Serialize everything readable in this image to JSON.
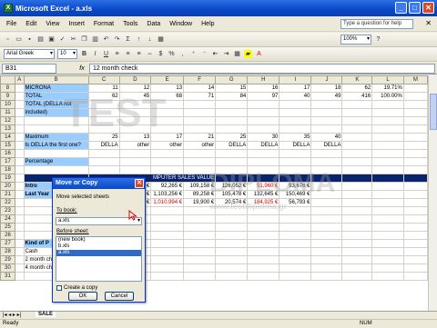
{
  "window": {
    "title": "Microsoft Excel - a.xls",
    "min": "_",
    "max": "□",
    "close": "✕"
  },
  "menus": [
    "File",
    "Edit",
    "View",
    "Insert",
    "Format",
    "Tools",
    "Data",
    "Window",
    "Help"
  ],
  "ask_box": "Type a question for help",
  "menu_close": "✕",
  "toolbar": {
    "zoom": "100%",
    "font": "Arial Greek",
    "size": "10",
    "bold": "B",
    "italic": "I",
    "underline": "U",
    "currency": "$",
    "percent": "%",
    "comma": ",",
    "fx": "fx"
  },
  "formula_bar": {
    "name_box": "B31",
    "content": "12 month check"
  },
  "sheet": {
    "columns": [
      "A",
      "B",
      "C",
      "D",
      "E",
      "F",
      "G",
      "H",
      "I",
      "J",
      "K",
      "L",
      "M"
    ],
    "rows": [
      {
        "n": "8",
        "b": "MICRONA",
        "c": "11",
        "d": "12",
        "e": "13",
        "f": "14",
        "g": "15",
        "h": "16",
        "i": "17",
        "j": "18",
        "k": "62",
        "l": "19.71%"
      },
      {
        "n": "9",
        "b": "TOTAL",
        "c": "62",
        "d": "45",
        "e": "68",
        "f": "71",
        "g": "84",
        "h": "97",
        "i": "40",
        "j": "49",
        "k": "416",
        "l": "100.00%"
      },
      {
        "n": "10",
        "b": "TOTAL (DELLA not",
        "c": "",
        "d": "",
        "e": "",
        "f": "",
        "g": "",
        "h": "",
        "i": "",
        "j": "",
        "k": "",
        "l": ""
      },
      {
        "n": "11",
        "b": "included)",
        "c": "",
        "d": "",
        "e": "",
        "f": "",
        "g": "",
        "h": "",
        "i": "",
        "j": "",
        "k": "",
        "l": ""
      },
      {
        "n": "12",
        "b": "",
        "c": "",
        "d": "",
        "e": "",
        "f": "",
        "g": "",
        "h": "",
        "i": "",
        "j": "",
        "k": "",
        "l": ""
      },
      {
        "n": "13",
        "b": "",
        "c": "",
        "d": "",
        "e": "",
        "f": "",
        "g": "",
        "h": "",
        "i": "",
        "j": "",
        "k": "",
        "l": ""
      },
      {
        "n": "14",
        "b": "Maximum",
        "c": "25",
        "d": "13",
        "e": "17",
        "f": "21",
        "g": "25",
        "h": "30",
        "i": "35",
        "j": "40",
        "k": "",
        "l": ""
      },
      {
        "n": "15",
        "b": "Is DELLA the first one?",
        "c": "DELLA",
        "d": "other",
        "e": "other",
        "f": "other",
        "g": "DELLA",
        "h": "DELLA",
        "i": "DELLA",
        "j": "DELLA",
        "k": "",
        "l": ""
      },
      {
        "n": "16",
        "b": "",
        "c": "",
        "d": "",
        "e": "",
        "f": "",
        "g": "",
        "h": "",
        "i": "",
        "j": "",
        "k": "",
        "l": ""
      },
      {
        "n": "17",
        "b": "Percentage",
        "c": "",
        "d": "",
        "e": "",
        "f": "",
        "g": "",
        "h": "",
        "i": "",
        "j": "",
        "k": "",
        "l": ""
      },
      {
        "n": "18",
        "b": "",
        "c": "",
        "d": "",
        "e": "",
        "f": "",
        "g": "",
        "h": "",
        "i": "",
        "j": "",
        "k": "",
        "l": ""
      },
      {
        "n": "19",
        "b": "",
        "c": "",
        "d": "",
        "e": "",
        "f": "",
        "g": "",
        "h": "",
        "i": "",
        "j": "",
        "k": "",
        "l": ""
      },
      {
        "n": "20",
        "b": "Intro",
        "c": "",
        "d": "75,371 €",
        "e": "92,265 €",
        "f": "109,158 €",
        "g": "126,052 €",
        "h": "51,960 €",
        "i": "93,676 €",
        "j": "",
        "k": "",
        "l": ""
      },
      {
        "n": "21",
        "b": "Last Year",
        "c": "",
        "d": "62,358 €",
        "e": "1,103,256 €",
        "f": "89,258 €",
        "g": "105,478 €",
        "h": "132,645 €",
        "i": "150,469 €",
        "j": "",
        "k": "",
        "l": ""
      },
      {
        "n": "22",
        "b": "",
        "c": "",
        "d": "13,013 €",
        "e": "1,010,994 €",
        "f": "19,900 €",
        "g": "20,574 €",
        "h": "184,925 €",
        "i": "56,793 €",
        "j": "",
        "k": "",
        "l": ""
      },
      {
        "n": "23",
        "b": "",
        "c": "",
        "d": "",
        "e": "",
        "f": "",
        "g": "",
        "h": "",
        "i": "",
        "j": "",
        "k": "",
        "l": ""
      },
      {
        "n": "24",
        "b": "",
        "c": "",
        "d": "",
        "e": "",
        "f": "",
        "g": "",
        "h": "",
        "i": "",
        "j": "",
        "k": "",
        "l": ""
      },
      {
        "n": "25",
        "b": "",
        "c": "",
        "d": "",
        "e": "",
        "f": "",
        "g": "",
        "h": "",
        "i": "",
        "j": "",
        "k": "",
        "l": ""
      },
      {
        "n": "26",
        "b": "",
        "c": "",
        "d": "",
        "e": "",
        "f": "",
        "g": "",
        "h": "",
        "i": "",
        "j": "",
        "k": "",
        "l": ""
      },
      {
        "n": "27",
        "b": "Kind of P",
        "c": "",
        "d": "",
        "e": "",
        "f": "",
        "g": "",
        "h": "",
        "i": "",
        "j": "",
        "k": "",
        "l": ""
      },
      {
        "n": "28",
        "b": "Cash",
        "c": "",
        "d": "",
        "e": "",
        "f": "",
        "g": "",
        "h": "",
        "i": "",
        "j": "",
        "k": "",
        "l": ""
      },
      {
        "n": "29",
        "b": "2 month ch",
        "c": "",
        "d": "",
        "e": "",
        "f": "",
        "g": "",
        "h": "",
        "i": "",
        "j": "",
        "k": "",
        "l": ""
      },
      {
        "n": "30",
        "b": "4 month ch",
        "c": "",
        "d": "",
        "e": "",
        "f": "",
        "g": "",
        "h": "",
        "i": "",
        "j": "",
        "k": "",
        "l": ""
      },
      {
        "n": "31",
        "b": "",
        "c": "",
        "d": "",
        "e": "",
        "f": "",
        "g": "",
        "h": "",
        "i": "",
        "j": "",
        "k": "",
        "l": ""
      }
    ],
    "header_band": "MPUTER SALES VALUE"
  },
  "dialog": {
    "title": "Move or Copy",
    "close": "✕",
    "instruction": "Move selected sheets",
    "to_book_label": "To book:",
    "to_book_value": "a.xls",
    "before_sheet_label": "Before sheet:",
    "list": [
      "(new book)",
      "b.xls",
      "a.xls"
    ],
    "selected_index": 2,
    "create_copy": "Create a copy",
    "ok": "OK",
    "cancel": "Cancel"
  },
  "tabs": {
    "sheet": "SALE"
  },
  "status": {
    "left": "Ready",
    "right": "NUM"
  },
  "watermark": {
    "line1": "TEST",
    "line2": "DIPLOMA",
    "line3": "www.testdiploma.gr"
  },
  "colors": {
    "titlebar": "#0a48c7",
    "dark_band": "#0a246a",
    "highlight": "#99ccff"
  }
}
